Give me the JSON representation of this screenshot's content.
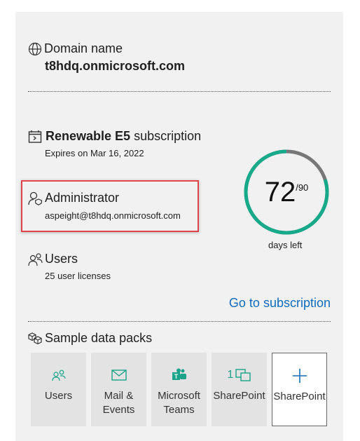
{
  "domain": {
    "heading": "Domain name",
    "value": "t8hdq.onmicrosoft.com"
  },
  "subscription": {
    "name_bold": "Renewable E5",
    "name_rest": "subscription",
    "expires": "Expires on Mar 16, 2022"
  },
  "administrator": {
    "heading": "Administrator",
    "email": "aspeight@t8hdq.onmicrosoft.com"
  },
  "users": {
    "heading": "Users",
    "licenses": "25 user licenses"
  },
  "days": {
    "remaining": "72",
    "total": "/90",
    "label": "days left",
    "fraction_remaining": 0.8
  },
  "go_to_subscription": "Go to subscription",
  "sample_data": {
    "heading": "Sample data packs",
    "tiles": [
      {
        "label": "Users",
        "icon": "people-icon"
      },
      {
        "label": "Mail &\nEvents",
        "icon": "mail-icon"
      },
      {
        "label": "Microsoft\nTeams",
        "icon": "teams-icon"
      },
      {
        "label": "SharePoint",
        "icon": "sharepoint-icon",
        "badge": "1"
      },
      {
        "label": "SharePoint",
        "icon": "add-icon"
      }
    ]
  },
  "colors": {
    "accent": "#16a98a",
    "ring_track": "#777777",
    "link": "#0f6cbd",
    "highlight": "#e0434a"
  }
}
